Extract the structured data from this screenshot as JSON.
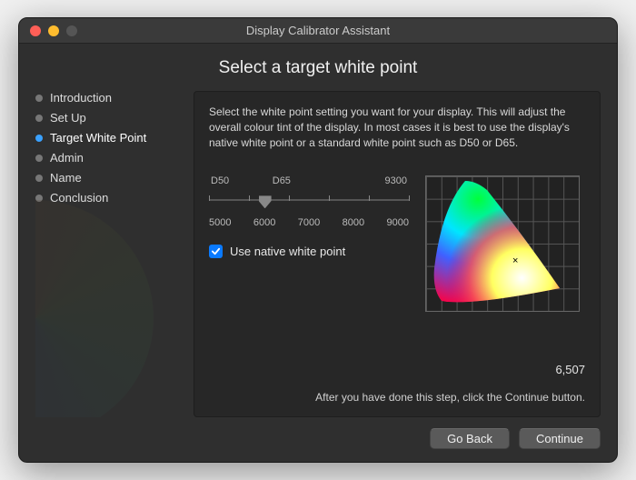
{
  "window": {
    "title": "Display Calibrator Assistant"
  },
  "heading": "Select a target white point",
  "sidebar": {
    "items": [
      {
        "label": "Introduction"
      },
      {
        "label": "Set Up"
      },
      {
        "label": "Target White Point"
      },
      {
        "label": "Admin"
      },
      {
        "label": "Name"
      },
      {
        "label": "Conclusion"
      }
    ],
    "active_index": 2
  },
  "panel": {
    "description": "Select the white point setting you want for your display. This will adjust the overall colour tint of the display. In most cases it is best to use the display's native white point or a standard white point such as D50 or D65.",
    "slider": {
      "top_labels": [
        "D50",
        "D65",
        "9300"
      ],
      "bottom_labels": [
        "5000",
        "6000",
        "7000",
        "8000",
        "9000"
      ]
    },
    "checkbox": {
      "checked": true,
      "label": "Use native white point"
    },
    "value": "6,507",
    "hint": "After you have done this step, click the Continue button."
  },
  "footer": {
    "back": "Go Back",
    "continue": "Continue"
  }
}
